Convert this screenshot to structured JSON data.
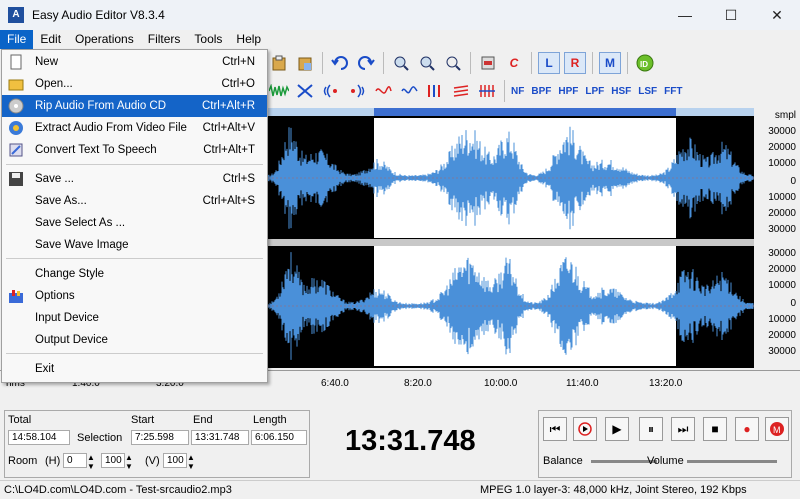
{
  "window": {
    "title": "Easy Audio Editor V8.3.4",
    "app_icon_letter": "A",
    "minimize": "—",
    "maximize": "☐",
    "close": "✕"
  },
  "menubar": [
    "File",
    "Edit",
    "Operations",
    "Filters",
    "Tools",
    "Help"
  ],
  "file_menu": {
    "items": [
      {
        "label": "New",
        "shortcut": "Ctrl+N",
        "icon": "new-file-icon"
      },
      {
        "label": "Open...",
        "shortcut": "Ctrl+O",
        "icon": "open-file-icon"
      },
      {
        "label": "Rip Audio From Audio CD",
        "shortcut": "Ctrl+Alt+R",
        "icon": "cd-icon"
      },
      {
        "label": "Extract Audio From Video File",
        "shortcut": "Ctrl+Alt+V",
        "icon": "video-icon"
      },
      {
        "label": "Convert Text To Speech",
        "shortcut": "Ctrl+Alt+T",
        "icon": "text-speech-icon"
      },
      {
        "label": "Save ...",
        "shortcut": "Ctrl+S",
        "icon": "save-icon"
      },
      {
        "label": "Save As...",
        "shortcut": "Ctrl+Alt+S",
        "icon": ""
      },
      {
        "label": "Save Select As ...",
        "shortcut": "",
        "icon": ""
      },
      {
        "label": "Save Wave Image",
        "shortcut": "",
        "icon": ""
      },
      {
        "label": "Change Style",
        "shortcut": "",
        "icon": ""
      },
      {
        "label": "Options",
        "shortcut": "",
        "icon": "options-icon"
      },
      {
        "label": "Input Device",
        "shortcut": "",
        "icon": ""
      },
      {
        "label": "Output Device",
        "shortcut": "",
        "icon": ""
      },
      {
        "label": "Exit",
        "shortcut": "",
        "icon": ""
      }
    ]
  },
  "toolbar1": {
    "left_btn": "L",
    "right_btn": "R",
    "m_btn": "M",
    "copy_label": "C"
  },
  "toolbar2": {
    "filters": [
      "NF",
      "BPF",
      "HPF",
      "LPF",
      "HSF",
      "LSF",
      "FFT"
    ]
  },
  "amplitude_unit": "smpl",
  "amplitude_labels": [
    "30000",
    "20000",
    "10000",
    "0",
    "10000",
    "20000",
    "30000"
  ],
  "time_axis": {
    "unit": "hms",
    "labels": [
      "1:40.0",
      "3:20.0",
      "6:40.0",
      "8:20.0",
      "10:00.0",
      "11:40.0",
      "13:20.0"
    ]
  },
  "info": {
    "total_label": "Total",
    "total_value": "14:58.104",
    "selection_label": "Selection",
    "start_label": "Start",
    "start_value": "7:25.598",
    "end_label": "End",
    "end_value": "13:31.748",
    "length_label": "Length",
    "length_value": "6:06.150",
    "room_label": "Room",
    "h_label": "(H)",
    "h_value1": "0",
    "h_value2": "100",
    "v_label": "(V)",
    "v_value": "100"
  },
  "big_time": "13:31.748",
  "transport": {
    "balance_label": "Balance",
    "volume_label": "Volume"
  },
  "status": {
    "path": "C:\\LO4D.com\\LO4D.com - Test-srcaudio2.mp3",
    "format": "MPEG 1.0 layer-3: 48,000 kHz, Joint Stereo, 192 Kbps"
  },
  "colors": {
    "wave": "#4a90d9",
    "selection_bg": "#ffffff",
    "unselected_bg": "#000000",
    "menu_highlight": "#1464c8"
  }
}
